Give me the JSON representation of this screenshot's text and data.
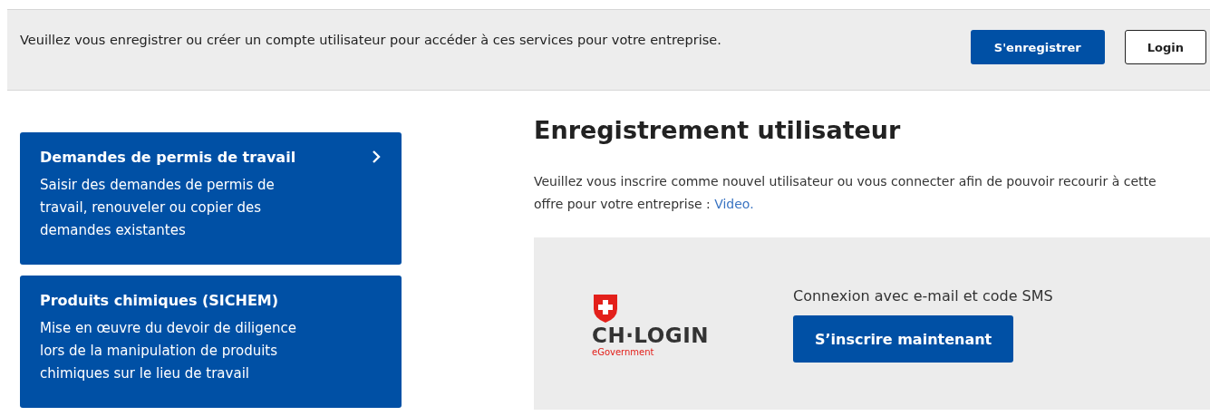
{
  "banner": {
    "text": "Veuillez vous enregistrer ou créer un compte utilisateur pour accéder à ces services pour votre entreprise.",
    "buttons": [
      {
        "label": "S'enregistrer",
        "kind": "primary"
      },
      {
        "label": "Login",
        "kind": "outline"
      }
    ]
  },
  "services": [
    {
      "title": "Demandes de permis de travail",
      "description": "Saisir des demandes de permis de travail, renouveler ou copier des demandes existantes",
      "has_arrow": true
    },
    {
      "title": "Produits chimiques (SICHEM)",
      "description": "Mise en œuvre du devoir de diligence lors de la manipulation de produits chimiques sur le lieu de travail",
      "has_arrow": false
    }
  ],
  "registration": {
    "heading": "Enregistrement utilisateur",
    "intro_lines": [
      "Veuillez vous inscrire comme nouvel utilisateur ou vous connecter afin de pouvoir recourir à cette",
      "offre pour votre entreprise : "
    ],
    "link": "Video.",
    "login_box": {
      "logo_text": "CH·LOGIN",
      "logo_tagline": "eGovernment",
      "caption": "Connexion avec e-mail et code SMS",
      "button": "S’inscrire maintenant"
    }
  }
}
